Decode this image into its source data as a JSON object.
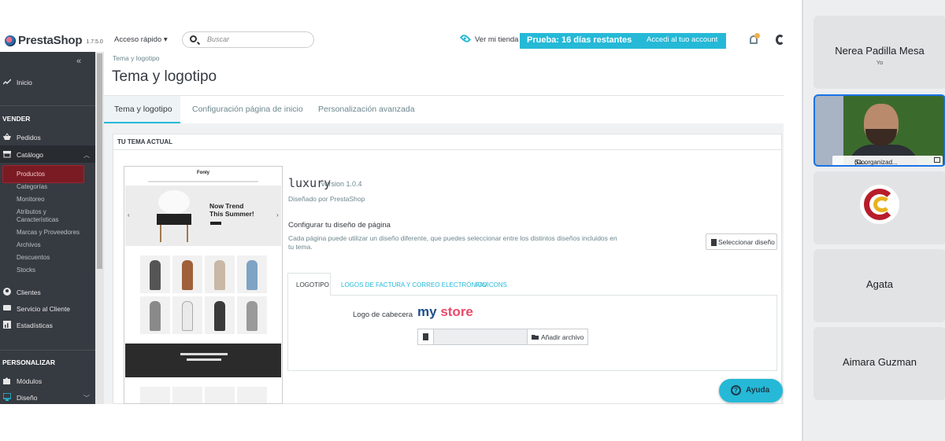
{
  "header": {
    "brand": "PrestaShop",
    "version": "1.7.5.0",
    "quick_access": "Acceso rápido ▾",
    "search_placeholder": "Buscar",
    "view_store": "Ver mi tienda",
    "trial_text": "Prueba: 16 días restantes",
    "trial_link": "Accedi al tuo account",
    "notifications_count": ""
  },
  "sidebar": {
    "collapse": "«",
    "inicio": "Inicio",
    "sections": [
      "VENDER",
      "PERSONALIZAR"
    ],
    "vender_items": [
      "Pedidos",
      "Catálogo"
    ],
    "catalogo_sub": [
      "Productos",
      "Categorías",
      "Monitoreo",
      "Atributos y Características",
      "Marcas y Proveedores",
      "Archivos",
      "Descuentos",
      "Stocks"
    ],
    "more_items": [
      "Clientes",
      "Servicio al Cliente",
      "Estadísticas"
    ],
    "personalizar_items": [
      "Módulos",
      "Diseño"
    ]
  },
  "main": {
    "breadcrumb": "Tema y logotipo",
    "title": "Tema y logotipo",
    "tabs": [
      "Tema y logotipo",
      "Configuración página de inicio",
      "Personalización avanzada"
    ],
    "panel_title": "TU TEMA ACTUAL",
    "theme": {
      "name": "luxury",
      "version": "version 1.0.4",
      "by": "Diseñado por PrestaShop",
      "hero_line1": "Now Trend",
      "hero_line2": "This Summer!",
      "preview_logo": "Fonly"
    },
    "layout": {
      "heading": "Configurar tu diseño de página",
      "description": "Cada página puede utilizar un diseño diferente, que puedes seleccionar entre los distintos diseños incluidos en tu tema.",
      "button": "Seleccionar diseño"
    },
    "subtabs": [
      "LOGOTIPO",
      "LOGOS DE FACTURA Y CORREO ELECTRÓNICO",
      "FAVICONS"
    ],
    "logo_label": "Logo de cabecera",
    "logo_text_my": "my",
    "logo_text_store": "store",
    "file_button": "Añadir archivo",
    "help_button": "Ayuda"
  },
  "meet": {
    "participants": [
      {
        "name": "Nerea Padilla Mesa",
        "note": "Yo"
      },
      {
        "name": "Sa...",
        "note": "(Coorganizad..."
      },
      {
        "name": "",
        "note": ""
      },
      {
        "name": "Agata",
        "note": ""
      },
      {
        "name": "Aimara Guzman",
        "note": ""
      }
    ]
  },
  "colors": {
    "accent": "#25b9d7",
    "sidebar": "#363a41",
    "active_item": "#7a1b24"
  }
}
